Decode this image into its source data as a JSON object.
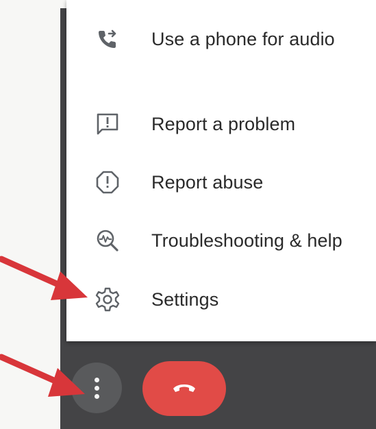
{
  "menu": {
    "items": [
      {
        "label": "Use a phone for audio",
        "icon": "phone-audio-icon"
      },
      {
        "label": "Report a problem",
        "icon": "report-problem-icon"
      },
      {
        "label": "Report abuse",
        "icon": "report-abuse-icon"
      },
      {
        "label": "Troubleshooting & help",
        "icon": "troubleshooting-icon"
      },
      {
        "label": "Settings",
        "icon": "gear-icon"
      }
    ]
  },
  "controls": {
    "more_options_icon": "more-vertical-icon",
    "hang_up_icon": "hang-up-icon"
  },
  "colors": {
    "menu_background": "#ffffff",
    "frame_background": "#444446",
    "hang_up": "#e14b47",
    "more_button": "#595a5c",
    "annotation_arrow": "#d8363a",
    "icon": "#5f6368"
  }
}
